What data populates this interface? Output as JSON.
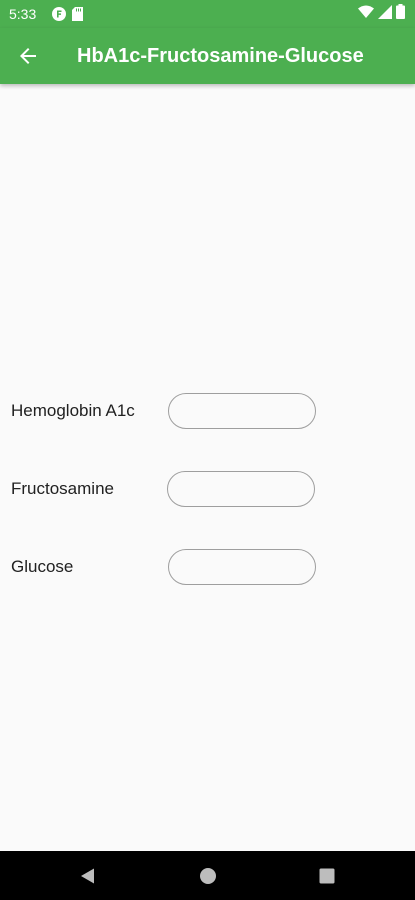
{
  "status_bar": {
    "time": "5:33",
    "left_icons": [
      "notification-f-icon",
      "sd-card-icon"
    ],
    "right_icons": [
      "wifi-icon",
      "cell-signal-icon",
      "battery-icon"
    ]
  },
  "app_bar": {
    "title": "HbA1c-Fructosamine-Glucose",
    "color": "#4caf50",
    "back_icon": "arrow-back-icon"
  },
  "form": {
    "fields": [
      {
        "label": "Hemoglobin A1c",
        "value": "",
        "placeholder": ""
      },
      {
        "label": "Fructosamine",
        "value": "",
        "placeholder": ""
      },
      {
        "label": "Glucose",
        "value": "",
        "placeholder": ""
      }
    ]
  },
  "nav_bar": {
    "buttons": [
      "nav-back-icon",
      "nav-home-icon",
      "nav-recents-icon"
    ]
  }
}
